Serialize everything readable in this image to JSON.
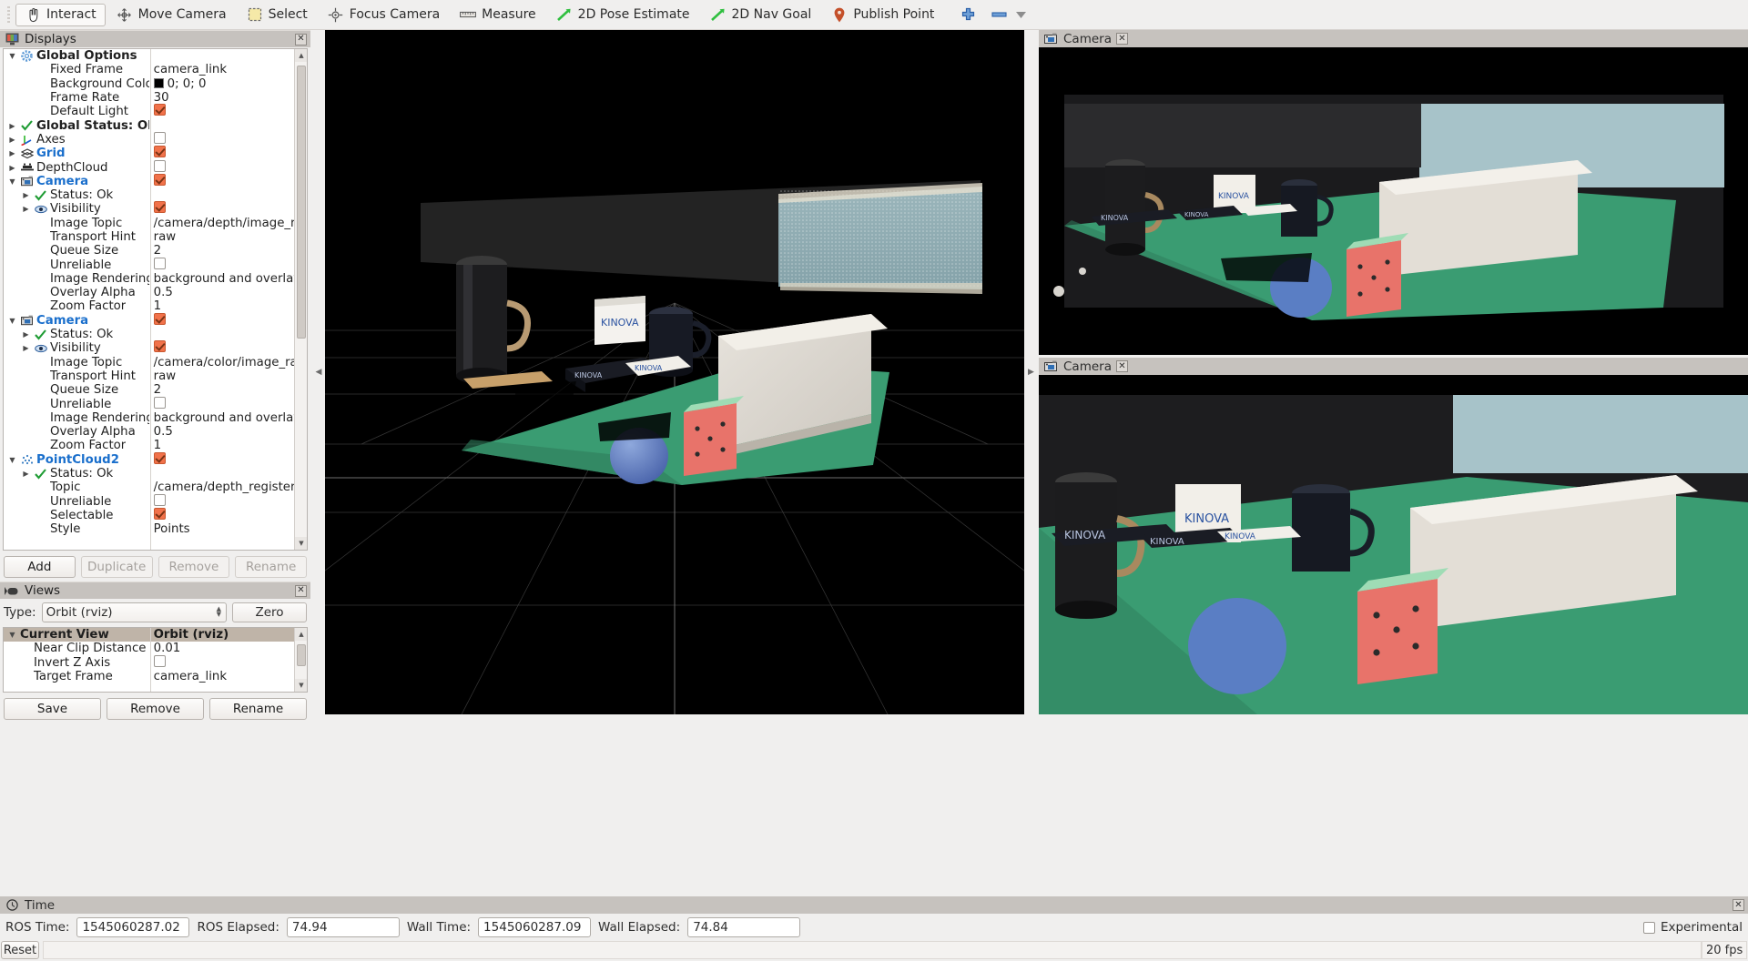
{
  "toolbar": {
    "buttons": [
      {
        "label": "Interact",
        "icon": "hand-cursor-icon",
        "active": true
      },
      {
        "label": "Move Camera",
        "icon": "move-camera-icon",
        "active": false
      },
      {
        "label": "Select",
        "icon": "select-rect-icon",
        "active": false
      },
      {
        "label": "Focus Camera",
        "icon": "focus-camera-icon",
        "active": false
      },
      {
        "label": "Measure",
        "icon": "ruler-icon",
        "active": false
      },
      {
        "label": "2D Pose Estimate",
        "icon": "green-arrow-icon",
        "active": false
      },
      {
        "label": "2D Nav Goal",
        "icon": "green-arrow-icon",
        "active": false
      },
      {
        "label": "Publish Point",
        "icon": "map-pin-icon",
        "active": false
      }
    ],
    "add_icon": "plus-icon",
    "remove_icon": "minus-icon",
    "overflow_icon": "chevron-down-icon"
  },
  "displays": {
    "title": "Displays",
    "title_icon": "displays-monitor-icon",
    "close_icon": "close-icon",
    "rows": [
      {
        "indent": 0,
        "arrow": "open",
        "icon": "gear-icon",
        "label": "Global Options",
        "bold": true,
        "value": "",
        "value_type": "none"
      },
      {
        "indent": 1,
        "arrow": "none",
        "icon": "none",
        "label": "Fixed Frame",
        "value": "camera_link",
        "value_type": "text"
      },
      {
        "indent": 1,
        "arrow": "none",
        "icon": "none",
        "label": "Background Color",
        "value": "0; 0; 0",
        "value_type": "color",
        "swatch": "#000000"
      },
      {
        "indent": 1,
        "arrow": "none",
        "icon": "none",
        "label": "Frame Rate",
        "value": "30",
        "value_type": "text"
      },
      {
        "indent": 1,
        "arrow": "none",
        "icon": "none",
        "label": "Default Light",
        "value": "",
        "value_type": "checkbox",
        "checked": true
      },
      {
        "indent": 0,
        "arrow": "closed",
        "icon": "status-ok-icon",
        "label": "Global Status: Ok",
        "bold": true,
        "value": "",
        "value_type": "none"
      },
      {
        "indent": 0,
        "arrow": "closed",
        "icon": "axes-icon",
        "label": "Axes",
        "value": "",
        "value_type": "checkbox",
        "checked": false
      },
      {
        "indent": 0,
        "arrow": "closed",
        "icon": "grid-icon",
        "label": "Grid",
        "enabled": true,
        "value": "",
        "value_type": "checkbox",
        "checked": true
      },
      {
        "indent": 0,
        "arrow": "closed",
        "icon": "depthcloud-icon",
        "label": "DepthCloud",
        "value": "",
        "value_type": "checkbox",
        "checked": false
      },
      {
        "indent": 0,
        "arrow": "open",
        "icon": "camera-icon",
        "label": "Camera",
        "enabled": true,
        "value": "",
        "value_type": "checkbox",
        "checked": true
      },
      {
        "indent": 1,
        "arrow": "closed",
        "icon": "status-ok-icon",
        "label": "Status: Ok",
        "value": "",
        "value_type": "none"
      },
      {
        "indent": 1,
        "arrow": "closed",
        "icon": "eye-icon",
        "label": "Visibility",
        "value": "",
        "value_type": "checkbox",
        "checked": true
      },
      {
        "indent": 1,
        "arrow": "none",
        "icon": "none",
        "label": "Image Topic",
        "value": "/camera/depth/image_rect",
        "value_type": "text"
      },
      {
        "indent": 1,
        "arrow": "none",
        "icon": "none",
        "label": "Transport Hint",
        "value": "raw",
        "value_type": "text"
      },
      {
        "indent": 1,
        "arrow": "none",
        "icon": "none",
        "label": "Queue Size",
        "value": "2",
        "value_type": "text"
      },
      {
        "indent": 1,
        "arrow": "none",
        "icon": "none",
        "label": "Unreliable",
        "value": "",
        "value_type": "checkbox",
        "checked": false
      },
      {
        "indent": 1,
        "arrow": "none",
        "icon": "none",
        "label": "Image Rendering",
        "value": "background and overlay",
        "value_type": "text"
      },
      {
        "indent": 1,
        "arrow": "none",
        "icon": "none",
        "label": "Overlay Alpha",
        "value": "0.5",
        "value_type": "text"
      },
      {
        "indent": 1,
        "arrow": "none",
        "icon": "none",
        "label": "Zoom Factor",
        "value": "1",
        "value_type": "text"
      },
      {
        "indent": 0,
        "arrow": "open",
        "icon": "camera-icon",
        "label": "Camera",
        "enabled": true,
        "value": "",
        "value_type": "checkbox",
        "checked": true
      },
      {
        "indent": 1,
        "arrow": "closed",
        "icon": "status-ok-icon",
        "label": "Status: Ok",
        "value": "",
        "value_type": "none"
      },
      {
        "indent": 1,
        "arrow": "closed",
        "icon": "eye-icon",
        "label": "Visibility",
        "value": "",
        "value_type": "checkbox",
        "checked": true
      },
      {
        "indent": 1,
        "arrow": "none",
        "icon": "none",
        "label": "Image Topic",
        "value": "/camera/color/image_raw",
        "value_type": "text"
      },
      {
        "indent": 1,
        "arrow": "none",
        "icon": "none",
        "label": "Transport Hint",
        "value": "raw",
        "value_type": "text"
      },
      {
        "indent": 1,
        "arrow": "none",
        "icon": "none",
        "label": "Queue Size",
        "value": "2",
        "value_type": "text"
      },
      {
        "indent": 1,
        "arrow": "none",
        "icon": "none",
        "label": "Unreliable",
        "value": "",
        "value_type": "checkbox",
        "checked": false
      },
      {
        "indent": 1,
        "arrow": "none",
        "icon": "none",
        "label": "Image Rendering",
        "value": "background and overlay",
        "value_type": "text"
      },
      {
        "indent": 1,
        "arrow": "none",
        "icon": "none",
        "label": "Overlay Alpha",
        "value": "0.5",
        "value_type": "text"
      },
      {
        "indent": 1,
        "arrow": "none",
        "icon": "none",
        "label": "Zoom Factor",
        "value": "1",
        "value_type": "text"
      },
      {
        "indent": 0,
        "arrow": "open",
        "icon": "pointcloud-icon",
        "label": "PointCloud2",
        "enabled": true,
        "value": "",
        "value_type": "checkbox",
        "checked": true
      },
      {
        "indent": 1,
        "arrow": "closed",
        "icon": "status-ok-icon",
        "label": "Status: Ok",
        "value": "",
        "value_type": "none"
      },
      {
        "indent": 1,
        "arrow": "none",
        "icon": "none",
        "label": "Topic",
        "value": "/camera/depth_registered...",
        "value_type": "text"
      },
      {
        "indent": 1,
        "arrow": "none",
        "icon": "none",
        "label": "Unreliable",
        "value": "",
        "value_type": "checkbox",
        "checked": false
      },
      {
        "indent": 1,
        "arrow": "none",
        "icon": "none",
        "label": "Selectable",
        "value": "",
        "value_type": "checkbox",
        "checked": true
      },
      {
        "indent": 1,
        "arrow": "none",
        "icon": "none",
        "label": "Style",
        "value": "Points",
        "value_type": "text"
      }
    ],
    "buttons": [
      {
        "label": "Add",
        "disabled": false
      },
      {
        "label": "Duplicate",
        "disabled": true
      },
      {
        "label": "Remove",
        "disabled": true
      },
      {
        "label": "Rename",
        "disabled": true
      }
    ]
  },
  "views": {
    "title": "Views",
    "title_icon": "views-camera-icon",
    "close_icon": "close-icon",
    "type_label": "Type:",
    "type_value": "Orbit (rviz)",
    "zero_label": "Zero",
    "rows": [
      {
        "indent": 0,
        "arrow": "open",
        "label": "Current View",
        "value": "Orbit (rviz)",
        "header": true,
        "value_type": "text"
      },
      {
        "indent": 1,
        "arrow": "none",
        "label": "Near Clip Distance",
        "value": "0.01",
        "value_type": "text"
      },
      {
        "indent": 1,
        "arrow": "none",
        "label": "Invert Z Axis",
        "value": "",
        "value_type": "checkbox",
        "checked": false
      },
      {
        "indent": 1,
        "arrow": "none",
        "label": "Target Frame",
        "value": "camera_link",
        "value_type": "text"
      }
    ],
    "buttons": [
      {
        "label": "Save",
        "disabled": false
      },
      {
        "label": "Remove",
        "disabled": false
      },
      {
        "label": "Rename",
        "disabled": false
      }
    ]
  },
  "cameras": [
    {
      "title": "Camera",
      "title_icon": "camera-icon",
      "close_icon": "close-icon"
    },
    {
      "title": "Camera",
      "title_icon": "camera-icon",
      "close_icon": "close-icon"
    }
  ],
  "time": {
    "title": "Time",
    "title_icon": "clock-icon",
    "close_icon": "close-icon",
    "fields": [
      {
        "label": "ROS Time:",
        "value": "1545060287.02"
      },
      {
        "label": "ROS Elapsed:",
        "value": "74.94"
      },
      {
        "label": "Wall Time:",
        "value": "1545060287.09"
      },
      {
        "label": "Wall Elapsed:",
        "value": "74.84"
      }
    ],
    "experimental_label": "Experimental",
    "experimental_checked": false,
    "reset_label": "Reset",
    "status_message": "",
    "fps": "20 fps"
  },
  "colors": {
    "checkbox_orange": "#f1724a",
    "enabled_blue": "#1a6fcc",
    "panel_header": "#c6c2be",
    "view_header": "#bfb4a8",
    "table_green": "#3a9c72",
    "cube_red": "#e8736a",
    "ball_blue": "#5a7ec4"
  }
}
